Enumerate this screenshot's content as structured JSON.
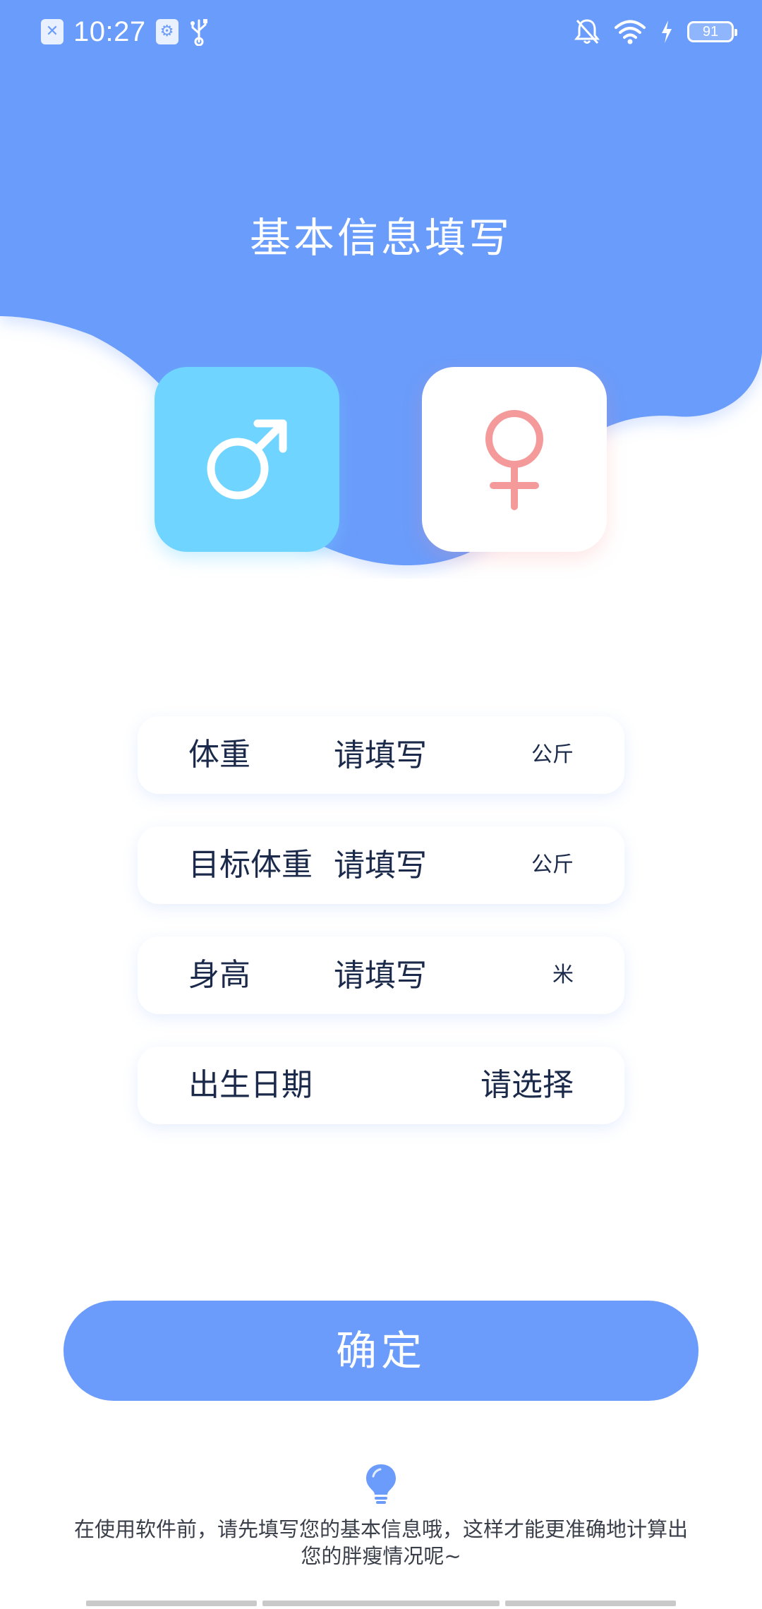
{
  "status_bar": {
    "time": "10:27",
    "battery": "91",
    "icons": [
      "sim-off-icon",
      "app-notification-icon",
      "usb-icon",
      "bell-muted-icon",
      "wifi-icon",
      "charging-icon",
      "battery-icon"
    ]
  },
  "page": {
    "title": "基本信息填写"
  },
  "gender": {
    "male_icon": "male-symbol-icon",
    "female_icon": "female-symbol-icon",
    "male_color": "#6fd4ff",
    "female_color": "#f49a9a"
  },
  "form": {
    "weight": {
      "label": "体重",
      "placeholder": "请填写",
      "unit": "公斤"
    },
    "target_weight": {
      "label": "目标体重",
      "placeholder": "请填写",
      "unit": "公斤"
    },
    "height": {
      "label": "身高",
      "placeholder": "请填写",
      "unit": "米"
    },
    "birth_date": {
      "label": "出生日期",
      "select_label": "请选择"
    }
  },
  "confirm": {
    "label": "确定"
  },
  "tip": {
    "icon": "lightbulb-icon",
    "text": "在使用软件前，请先填写您的基本信息哦，这样才能更准确地计算出您的胖瘦情况呢~"
  },
  "colors": {
    "primary": "#6b9cfb",
    "text_dark": "#1b2a4a",
    "male_card": "#6fd4ff",
    "female_symbol": "#f49a9a"
  }
}
